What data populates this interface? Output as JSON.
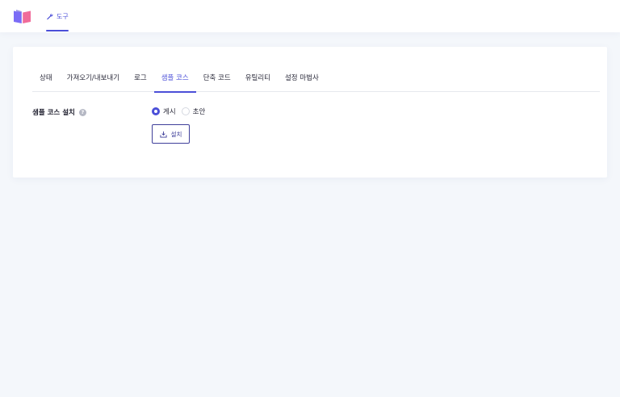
{
  "topbar": {
    "logo_icon": "book-logo-icon",
    "nav_item": {
      "label": "도구",
      "icon": "wrench-icon"
    }
  },
  "tabs": [
    {
      "label": "상태",
      "active": false
    },
    {
      "label": "가져오기/내보내기",
      "active": false
    },
    {
      "label": "로그",
      "active": false
    },
    {
      "label": "샘플 코스",
      "active": true
    },
    {
      "label": "단축 코드",
      "active": false
    },
    {
      "label": "유틸리티",
      "active": false
    },
    {
      "label": "설정 마법사",
      "active": false
    }
  ],
  "setting": {
    "label": "샘플 코스 설치",
    "help_icon": "question-icon",
    "options": [
      {
        "label": "게시",
        "checked": true
      },
      {
        "label": "초안",
        "checked": false
      }
    ],
    "install_button": {
      "label": "설치",
      "icon": "download-icon"
    }
  },
  "colors": {
    "accent": "#4b4fd8",
    "button_border": "#3f3f9a",
    "page_background": "#f4f7fb"
  }
}
